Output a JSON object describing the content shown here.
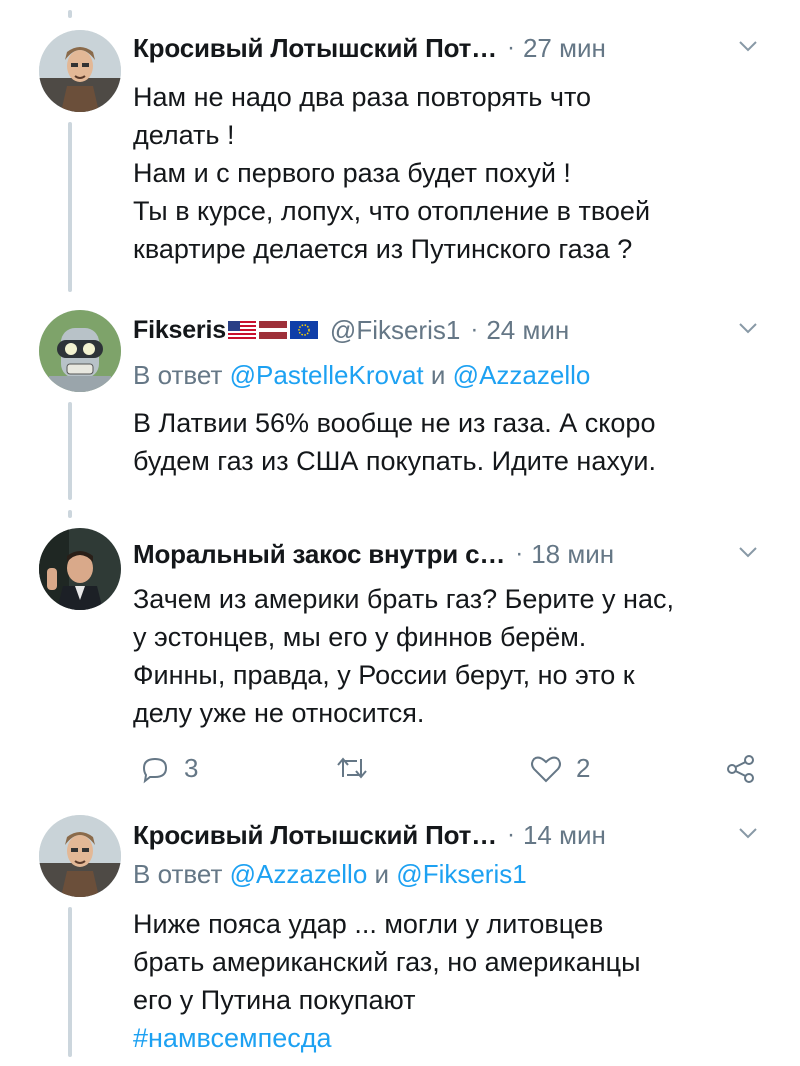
{
  "tweets": [
    {
      "name": "Кросивый Лотышский Пот…",
      "handle": "",
      "time": "27 мин",
      "reply_prefix": "",
      "reply_mentions": [],
      "reply_joiner": "",
      "lines": [
        "Нам не надо два раза повторять что",
        "делать !",
        "Нам и с первого раза будет похуй !",
        "Ты в курсе, лопух, что отопление в твоей",
        "квартире делается из Путинского газа ?"
      ]
    },
    {
      "name": "Fikseris",
      "handle": "@Fikseris1",
      "time": "24 мин",
      "reply_prefix": "В ответ",
      "reply_mentions": [
        "@PastelleKrovat",
        "@Azzazello"
      ],
      "reply_joiner": "и",
      "lines": [
        "В Латвии 56% вообще не из газа.  А скоро",
        "будем газ из США покупать. Идите  нахуи."
      ]
    },
    {
      "name": "Моральный закос внутри с…",
      "handle": "",
      "time": "18 мин",
      "lines": [
        "Зачем из америки брать газ? Берите у нас,",
        "у эстонцев, мы его у финнов берём.",
        "Финны, правда, у России берут, но это к",
        "делу уже не относится."
      ],
      "actions": {
        "replies": "3",
        "retweets": "",
        "likes": "2"
      }
    },
    {
      "name": "Кросивый Лотышский Пот…",
      "handle": "",
      "time": "14 мин",
      "reply_prefix": "В ответ",
      "reply_mentions": [
        "@Azzazello",
        "@Fikseris1"
      ],
      "reply_joiner": "и",
      "lines": [
        "Ниже пояса удар ... могли у литовцев",
        "брать американский газ, но американцы",
        "его у Путина покупают"
      ],
      "hashtag": "#намвсемпесда"
    }
  ],
  "separator": "·",
  "colors": {
    "text": "#14171a",
    "secondary": "#657786",
    "link": "#1da1f2",
    "thread_line": "#ccd6dd"
  },
  "icons": [
    "chevron-down-icon",
    "reply-icon",
    "retweet-icon",
    "like-icon",
    "share-icon"
  ]
}
